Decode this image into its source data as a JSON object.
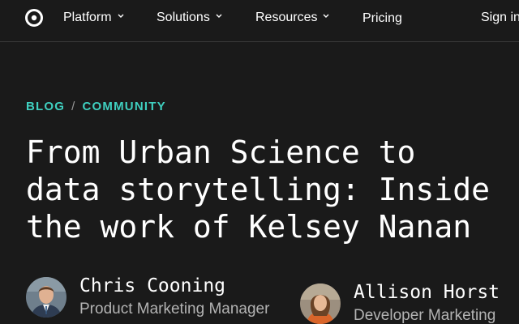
{
  "nav": {
    "logo_icon": "circle-logo-icon",
    "items": [
      {
        "label": "Platform",
        "has_dropdown": true
      },
      {
        "label": "Solutions",
        "has_dropdown": true
      },
      {
        "label": "Resources",
        "has_dropdown": true
      },
      {
        "label": "Pricing",
        "has_dropdown": false
      }
    ],
    "sign_in_label": "Sign in"
  },
  "breadcrumb": {
    "first": "BLOG",
    "separator": "/",
    "second": "COMMUNITY"
  },
  "article": {
    "title_lines": [
      "From Urban Science to",
      "data storytelling: Inside",
      "the work of Kelsey Nanan"
    ]
  },
  "authors": [
    {
      "name": "Chris Cooning",
      "role": "Product Marketing Manager",
      "avatar_icon": "avatar-chris"
    },
    {
      "name": "Allison Horst",
      "role": "Developer Marketing",
      "avatar_icon": "avatar-allison"
    }
  ],
  "colors": {
    "background": "#1a1a1a",
    "accent": "#3fd0c0",
    "text": "#ffffff",
    "muted": "#b3b3b3"
  }
}
